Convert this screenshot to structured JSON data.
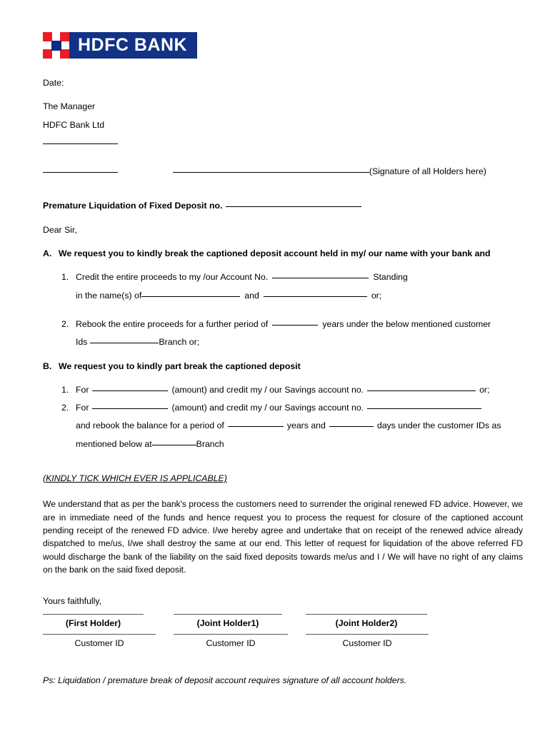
{
  "logo": {
    "name": "HDFC BANK",
    "mark_color": "#ec1c24",
    "band_color": "#123285",
    "core_color": "#0d2b84",
    "text_color": "#ffffff"
  },
  "header": {
    "date_label": "Date:",
    "addressee_line1": "The Manager",
    "addressee_line2": "HDFC Bank Ltd",
    "signature_note": "(Signature of all  Holders here)"
  },
  "subject": {
    "label": "Premature Liquidation of Fixed Deposit no."
  },
  "salutation": "Dear Sir,",
  "section_a": {
    "letter": "A.",
    "heading": "We request you to kindly break the captioned deposit account held in my/ our name with your bank and",
    "items": [
      {
        "num": "1.",
        "text_before": "Credit the entire proceeds to my /our Account No.",
        "text_after": "Standing",
        "cont_before": "in the name(s) of",
        "cont_middle": "and",
        "cont_after": "or;"
      },
      {
        "num": "2.",
        "text_before": "Rebook the entire proceeds for a further period of",
        "text_after": "years under the below mentioned customer",
        "cont_before": "Ids",
        "cont_after": "Branch or;"
      }
    ]
  },
  "section_b": {
    "letter": "B.",
    "heading": "We request you to kindly part break the captioned deposit",
    "items": [
      {
        "num": "1.",
        "t1": "For",
        "t2": "(amount) and credit my / our Savings account no.",
        "t3": "or;"
      },
      {
        "num": "2.",
        "t1": "For",
        "t2": "(amount) and credit my / our Savings account no.",
        "cont1": "and rebook the balance for a period of",
        "cont2": "years and",
        "cont3": "days under the customer IDs as",
        "cont4": "mentioned below at",
        "cont5": "Branch"
      }
    ]
  },
  "tick_note": "(KINDLY TICK WHICH EVER IS APPLICABLE)",
  "declaration": "We understand that as per the bank's process the customers need to surrender the original renewed FD advice. However, we are in immediate need of the funds and hence request you to process the request for closure of the captioned account pending receipt of the renewed FD advice.  I/we hereby agree and undertake that on receipt of the renewed advice already dispatched to me/us, I/we shall destroy the same at our end.  This letter of request for liquidation of the above referred FD would discharge the bank of the liability on the said fixed deposits towards me/us and I / We will have no right of any claims on the bank on the  said fixed deposit.",
  "closing": "Yours faithfully,",
  "signatures": {
    "holders": [
      {
        "caption": "(First Holder)",
        "id_caption": "Customer ID"
      },
      {
        "caption": "(Joint Holder1)",
        "id_caption": "Customer ID"
      },
      {
        "caption": "(Joint Holder2)",
        "id_caption": "Customer ID"
      }
    ]
  },
  "postscript": "Ps:  Liquidation / premature break of deposit account requires signature of all account holders."
}
